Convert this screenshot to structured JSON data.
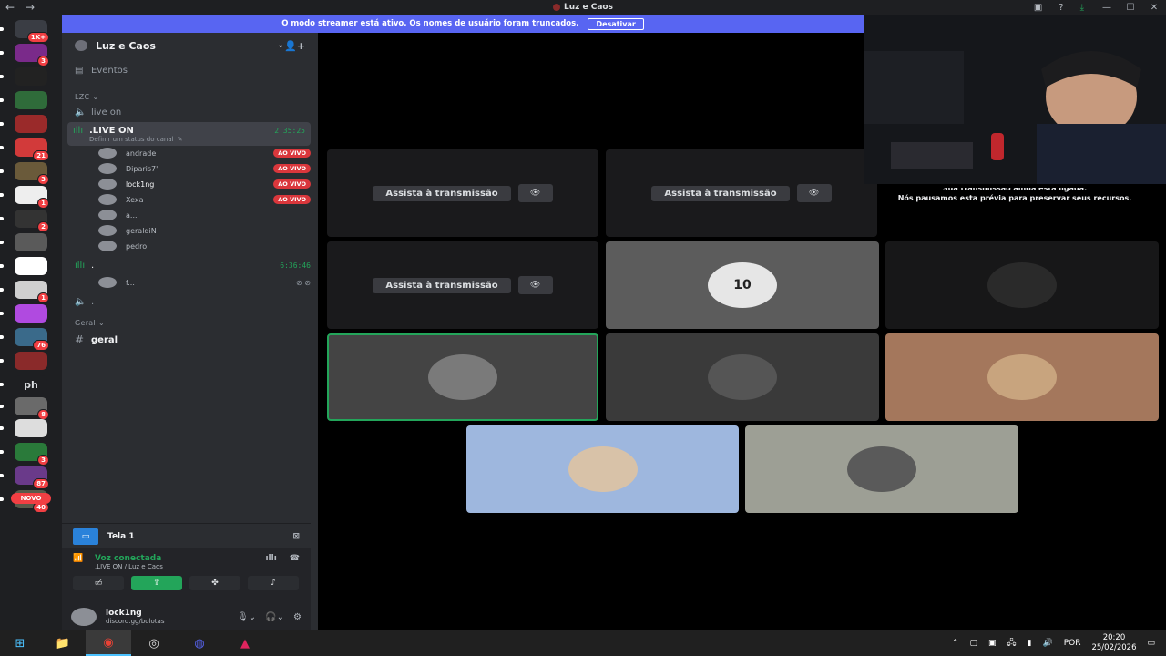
{
  "window": {
    "title": "Luz e Caos"
  },
  "banner": {
    "text": "O modo streamer está ativo. Os nomes de usuário foram truncados.",
    "button": "Desativar"
  },
  "guilds": [
    {
      "badge": "1K+",
      "color": "#3a3d44"
    },
    {
      "badge": "3",
      "color": "#7a2a8a"
    },
    {
      "badge": "",
      "color": "#222222"
    },
    {
      "badge": "",
      "color": "#2f6b3a"
    },
    {
      "badge": "",
      "color": "#9a2a2a"
    },
    {
      "badge": "21",
      "color": "#d23a3a"
    },
    {
      "badge": "3",
      "color": "#6a5a3a"
    },
    {
      "badge": "1",
      "color": "#eeeeee"
    },
    {
      "badge": "2",
      "color": "#333333"
    },
    {
      "badge": "",
      "color": "#5a5a5a"
    },
    {
      "badge": "",
      "color": "#ffffff"
    },
    {
      "badge": "1",
      "color": "#cfcfcf"
    },
    {
      "badge": "",
      "color": "#b04ae0"
    },
    {
      "badge": "76",
      "color": "#3a6a8a"
    },
    {
      "badge": "",
      "color": "#8a2a2a"
    },
    {
      "badge": "",
      "label": "ph",
      "color": "#1e1f22"
    },
    {
      "badge": "8",
      "color": "#6a6a6a"
    },
    {
      "badge": "",
      "color": "#dddddd"
    },
    {
      "badge": "3",
      "color": "#2a7a3a"
    },
    {
      "badge": "87",
      "color": "#6a3a8a"
    },
    {
      "badge": "40",
      "color": "#5a5a4a"
    }
  ],
  "novo_label": "NOVO",
  "sidebar": {
    "server_name": "Luz e Caos",
    "events": "Eventos",
    "category_lzc": "LZC",
    "channel_live_on_text": "live on",
    "active_channel": {
      "name": ".LIVE ON",
      "status": "Definir um status do canal",
      "timer": "2:35:25"
    },
    "voice_users": [
      {
        "name": "andrade",
        "live": "AO VIVO"
      },
      {
        "name": "Diparis7'",
        "live": "AO VIVO"
      },
      {
        "name": "lock1ng",
        "live": "AO VIVO"
      },
      {
        "name": "Xexa",
        "live": "AO VIVO"
      },
      {
        "name": "a...",
        "live": ""
      },
      {
        "name": "geraldiN",
        "live": ""
      },
      {
        "name": "pedro",
        "live": ""
      }
    ],
    "second_channel": {
      "name": ".",
      "timer": "6:36:46"
    },
    "second_user": {
      "name": "f..."
    },
    "third_channel": ".",
    "category_geral": "Geral",
    "geral_channel": "geral"
  },
  "panel": {
    "screen_title": "Tela 1",
    "voice_status": "Voz conectada",
    "voice_sub": ".LIVE ON / Luz e Caos",
    "user_name": "lock1ng",
    "user_status": "discord.gg/bolotas"
  },
  "stage": {
    "watch_label": "Assista à transmissão",
    "tile_labels": [
      "10"
    ]
  },
  "webcam_text": {
    "line1": "Sua transmissão ainda está ligada.",
    "line2": "Nós pausamos esta prévia para preservar seus recursos."
  },
  "taskbar": {
    "lang": "POR",
    "time": "20:20",
    "date": "25/02/2026"
  }
}
